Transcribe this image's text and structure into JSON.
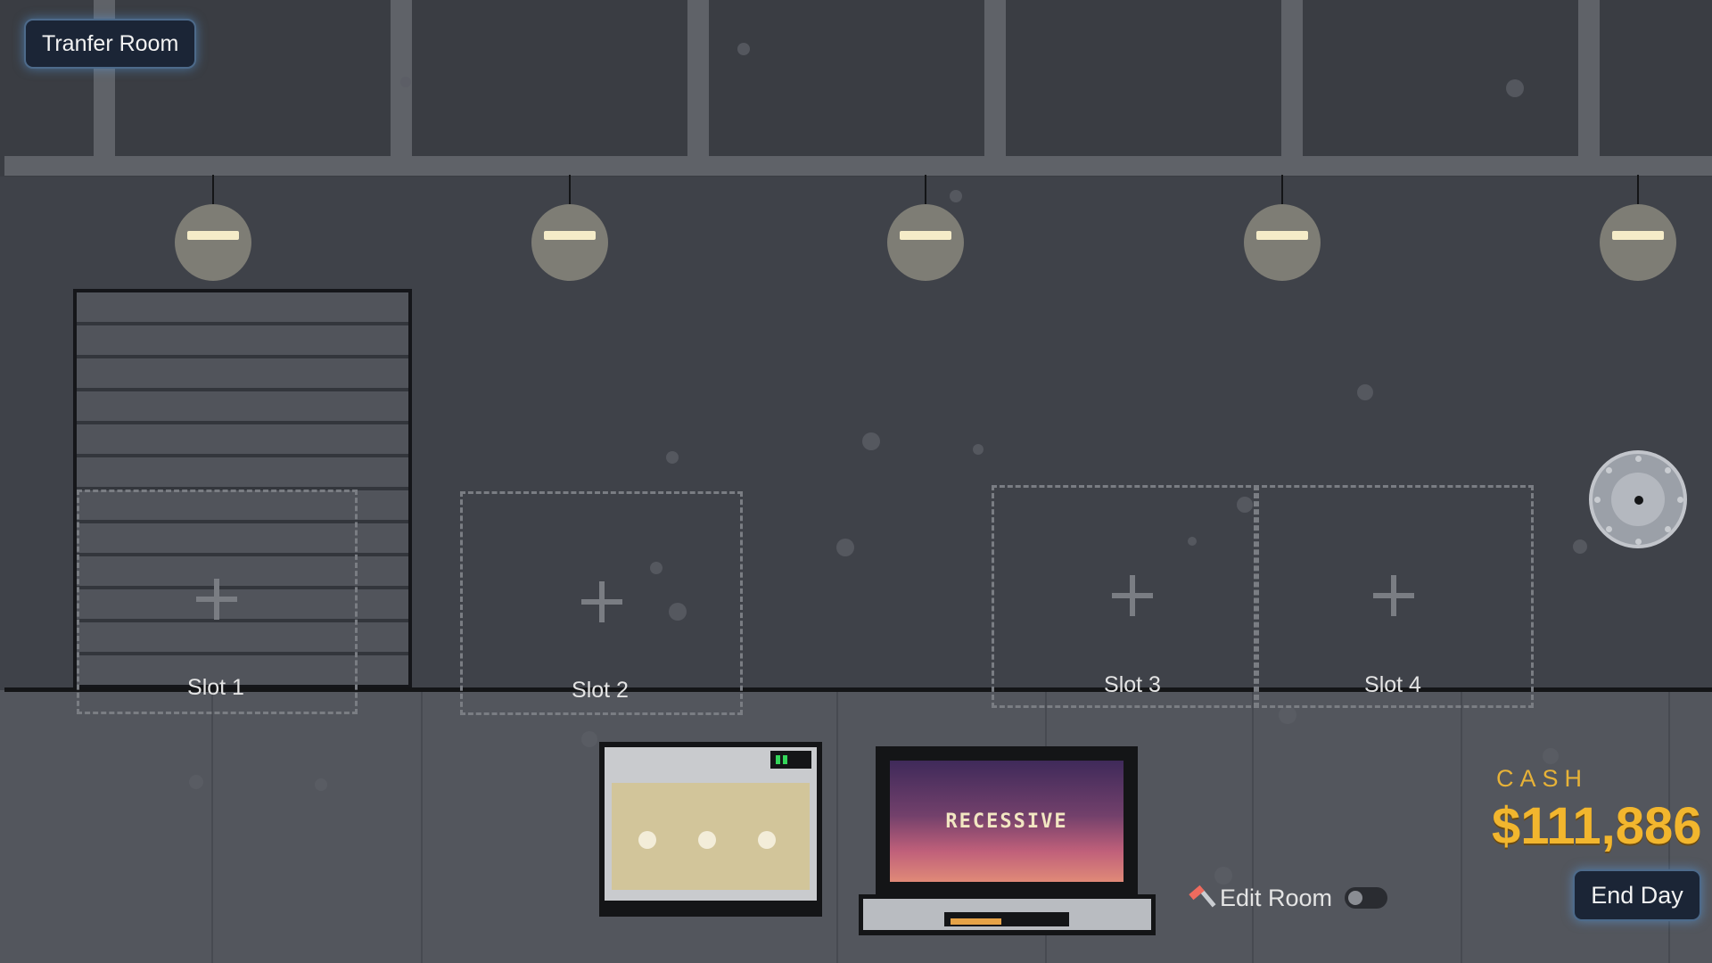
{
  "room": {
    "title": "Tranfer Room"
  },
  "slots": [
    {
      "label": "Slot 1"
    },
    {
      "label": "Slot 2"
    },
    {
      "label": "Slot 3"
    },
    {
      "label": "Slot 4"
    }
  ],
  "laptop": {
    "screen_text": "RECESSIVE",
    "battery_fraction": 0.45
  },
  "hud": {
    "cash_label": "CASH",
    "cash_value": "$111,886",
    "edit_room_label": "Edit Room",
    "edit_room_enabled": false,
    "end_day_label": "End Day"
  },
  "colors": {
    "accent_gold": "#f2b62e",
    "button_bg": "#1b2536",
    "button_glow": "#5aa0e6",
    "screen_gradient_top": "#3f2a5a",
    "screen_gradient_bottom": "#e08a78"
  },
  "icons": [
    "hammer-icon",
    "vault-dial-icon"
  ]
}
